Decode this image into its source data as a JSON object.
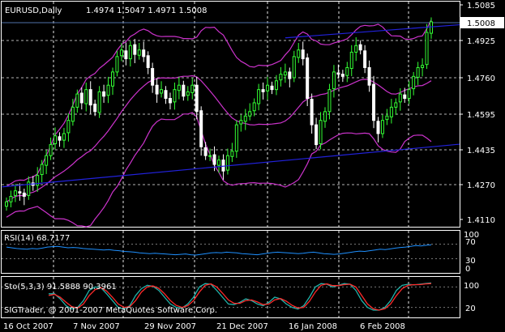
{
  "chart_header": {
    "symbol": "EURUSD,Daily",
    "ohlc": "1.4974 1.5047 1.4971 1.5008"
  },
  "price_axis": {
    "ticks": [
      "1.5085",
      "1.4925",
      "1.4760",
      "1.4595",
      "1.4435",
      "1.4270",
      "1.4110"
    ],
    "current_price": "1.5008"
  },
  "rsi_panel": {
    "label": "RSI(14) 68.7177",
    "ticks": [
      "100",
      "70",
      "30",
      "0"
    ]
  },
  "stoch_panel": {
    "label": "Sto(5,3,3) 91.5888 90.3961",
    "copyright": "SIGTrader, @ 2001-2007 MetaQuotes Software Corp.",
    "ticks": [
      "100",
      "20"
    ]
  },
  "date_axis": {
    "ticks": [
      "16 Oct 2007",
      "7 Nov 2007",
      "29 Nov 2007",
      "21 Dec 2007",
      "16 Jan 2008",
      "6 Feb 2008"
    ]
  },
  "colors": {
    "background": "#000000",
    "bull_candle": "#33ff33",
    "bear_candle": "#ffffff",
    "bands": "#cc33cc",
    "trendline": "#2222dd",
    "rsi_line": "#1e90ff",
    "stoch_main": "#20b2aa",
    "stoch_signal": "#ff2a2a",
    "grid": "#ffffff"
  },
  "chart_data": {
    "type": "candlestick",
    "title": "EURUSD,Daily",
    "ylim": [
      1.409,
      1.511
    ],
    "x": [
      "2007-10-16",
      "2007-10-17",
      "2007-10-18",
      "2007-10-19",
      "2007-10-22",
      "2007-10-23",
      "2007-10-24",
      "2007-10-25",
      "2007-10-26",
      "2007-10-29",
      "2007-10-30",
      "2007-10-31",
      "2007-11-01",
      "2007-11-02",
      "2007-11-05",
      "2007-11-06",
      "2007-11-07",
      "2007-11-08",
      "2007-11-09",
      "2007-11-12",
      "2007-11-13",
      "2007-11-14",
      "2007-11-15",
      "2007-11-16",
      "2007-11-19",
      "2007-11-20",
      "2007-11-21",
      "2007-11-22",
      "2007-11-23",
      "2007-11-26",
      "2007-11-27",
      "2007-11-28",
      "2007-11-29",
      "2007-11-30",
      "2007-12-03",
      "2007-12-04",
      "2007-12-05",
      "2007-12-06",
      "2007-12-07",
      "2007-12-10",
      "2007-12-11",
      "2007-12-12",
      "2007-12-13",
      "2007-12-14",
      "2007-12-17",
      "2007-12-18",
      "2007-12-19",
      "2007-12-20",
      "2007-12-21",
      "2007-12-24",
      "2007-12-25",
      "2007-12-26",
      "2007-12-27",
      "2007-12-28",
      "2007-12-31",
      "2008-01-01",
      "2008-01-02",
      "2008-01-03",
      "2008-01-04",
      "2008-01-07",
      "2008-01-08",
      "2008-01-09",
      "2008-01-10",
      "2008-01-11",
      "2008-01-14",
      "2008-01-15",
      "2008-01-16",
      "2008-01-17",
      "2008-01-18",
      "2008-01-21",
      "2008-01-22",
      "2008-01-23",
      "2008-01-24",
      "2008-01-25",
      "2008-01-28",
      "2008-01-29",
      "2008-01-30",
      "2008-01-31",
      "2008-02-01",
      "2008-02-04",
      "2008-02-05",
      "2008-02-06",
      "2008-02-07",
      "2008-02-08",
      "2008-02-11",
      "2008-02-12",
      "2008-02-13",
      "2008-02-14",
      "2008-02-15",
      "2008-02-18",
      "2008-02-19",
      "2008-02-20",
      "2008-02-21",
      "2008-02-22",
      "2008-02-25",
      "2008-02-26",
      "2008-02-27"
    ],
    "close": [
      1.419,
      1.4215,
      1.424,
      1.423,
      1.4215,
      1.428,
      1.4265,
      1.431,
      1.436,
      1.44,
      1.445,
      1.449,
      1.447,
      1.45,
      1.456,
      1.462,
      1.468,
      1.464,
      1.47,
      1.463,
      1.46,
      1.469,
      1.467,
      1.472,
      1.478,
      1.485,
      1.488,
      1.484,
      1.49,
      1.486,
      1.488,
      1.485,
      1.48,
      1.472,
      1.468,
      1.47,
      1.466,
      1.464,
      1.47,
      1.472,
      1.467,
      1.469,
      1.472,
      1.46,
      1.444,
      1.44,
      1.44,
      1.436,
      1.438,
      1.433,
      1.44,
      1.442,
      1.454,
      1.456,
      1.458,
      1.46,
      1.464,
      1.47,
      1.469,
      1.472,
      1.47,
      1.474,
      1.477,
      1.478,
      1.475,
      1.485,
      1.488,
      1.484,
      1.466,
      1.454,
      1.445,
      1.456,
      1.46,
      1.47,
      1.478,
      1.477,
      1.476,
      1.48,
      1.487,
      1.49,
      1.488,
      1.48,
      1.472,
      1.456,
      1.45,
      1.456,
      1.458,
      1.462,
      1.464,
      1.468,
      1.466,
      1.47,
      1.476,
      1.48,
      1.481,
      1.496,
      1.5008
    ],
    "lines": [
      {
        "name": "",
        "x": [
          "2007-10-16",
          "2008-02-27"
        ],
        "y": [
          1.426,
          1.444
        ]
      },
      {
        "name": "",
        "x": [
          "2008-01-11",
          "2008-02-27"
        ],
        "y": [
          1.4935,
          1.4985
        ]
      }
    ],
    "subplots": [
      {
        "type": "line",
        "title": "RSI(14) 68.7177",
        "ylim": [
          0,
          100
        ],
        "ticks": [
          100,
          70,
          30,
          0
        ],
        "values": [
          62,
          60,
          58,
          57,
          56,
          58,
          57,
          59,
          62,
          63,
          64,
          62,
          60,
          61,
          60,
          58,
          57,
          56,
          55,
          54,
          55,
          53,
          52,
          50,
          49,
          48,
          46,
          45,
          44,
          45,
          44,
          43,
          42,
          41,
          42,
          43,
          41,
          40,
          42,
          44,
          46,
          47,
          46,
          48,
          47,
          46,
          44,
          43,
          42,
          41,
          43,
          45,
          47,
          48,
          47,
          46,
          45,
          44,
          45,
          47,
          48,
          46,
          44,
          43,
          42,
          43,
          45,
          47,
          49,
          51,
          50,
          52,
          54,
          56,
          55,
          57,
          59,
          61,
          62,
          64,
          66,
          65,
          67,
          68
        ]
      },
      {
        "type": "line",
        "title": "Sto(5,3,3) 91.5888 90.3961",
        "ylim": [
          0,
          100
        ],
        "ticks": [
          100,
          20
        ],
        "series": [
          {
            "name": "",
            "values": [
              60,
              60,
              45,
              25,
              15,
              20,
              40,
              70,
              80,
              78,
              60,
              40,
              20,
              15,
              25,
              55,
              75,
              85,
              82,
              70,
              50,
              30,
              20,
              18,
              30,
              50,
              80,
              90,
              88,
              70,
              50,
              30,
              28,
              35,
              45,
              40,
              30,
              25,
              35,
              50,
              45,
              30,
              20,
              15,
              25,
              50,
              80,
              90,
              88,
              80,
              85,
              90,
              88,
              70,
              40,
              20,
              12,
              12,
              20,
              40,
              70,
              85,
              88,
              86,
              88,
              90,
              92
            ]
          },
          {
            "name": "",
            "values": [
              55,
              58,
              50,
              35,
              22,
              18,
              30,
              55,
              72,
              78,
              68,
              50,
              30,
              20,
              22,
              40,
              65,
              80,
              83,
              76,
              60,
              40,
              26,
              20,
              25,
              40,
              65,
              85,
              89,
              80,
              62,
              42,
              32,
              32,
              40,
              42,
              36,
              28,
              30,
              42,
              46,
              38,
              26,
              18,
              20,
              38,
              65,
              85,
              89,
              84,
              84,
              87,
              88,
              80,
              55,
              30,
              16,
              12,
              16,
              30,
              55,
              75,
              85,
              87,
              87,
              89,
              90
            ]
          }
        ]
      }
    ]
  }
}
